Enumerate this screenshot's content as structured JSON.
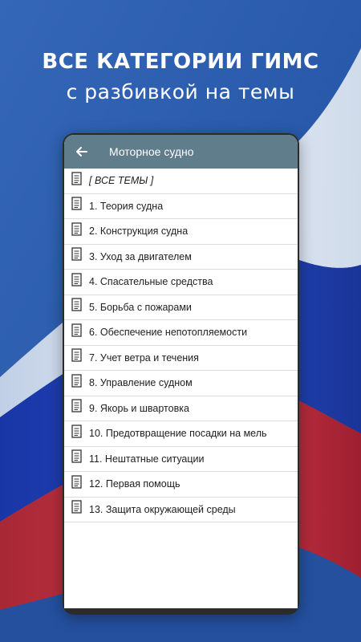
{
  "headline": {
    "line1": "ВСЕ КАТЕГОРИИ ГИМС",
    "line2": "с разбивкой на темы"
  },
  "appbar": {
    "back_icon": "arrow-back-icon",
    "title": "Моторное судно"
  },
  "list": {
    "item_icon": "document-icon",
    "items": [
      {
        "label": "[ ВСЕ ТЕМЫ ]"
      },
      {
        "label": "1. Теория судна"
      },
      {
        "label": "2. Конструкция судна"
      },
      {
        "label": "3. Уход за двигателем"
      },
      {
        "label": "4. Спасательные средства"
      },
      {
        "label": "5. Борьба с пожарами"
      },
      {
        "label": "6. Обеспечение непотопляемости"
      },
      {
        "label": "7. Учет ветра и течения"
      },
      {
        "label": "8. Управление судном"
      },
      {
        "label": "9. Якорь и швартовка"
      },
      {
        "label": "10. Предотвращение посадки на мель"
      },
      {
        "label": "11. Нештатные ситуации"
      },
      {
        "label": "12. Первая помощь"
      },
      {
        "label": "13. Защита окружающей среды"
      }
    ]
  },
  "colors": {
    "appbar": "#607d8b",
    "background_blue": "#2a5aa8",
    "flag_white": "#e8eef5",
    "flag_blue": "#1f3fa8",
    "flag_red": "#c0303e"
  }
}
